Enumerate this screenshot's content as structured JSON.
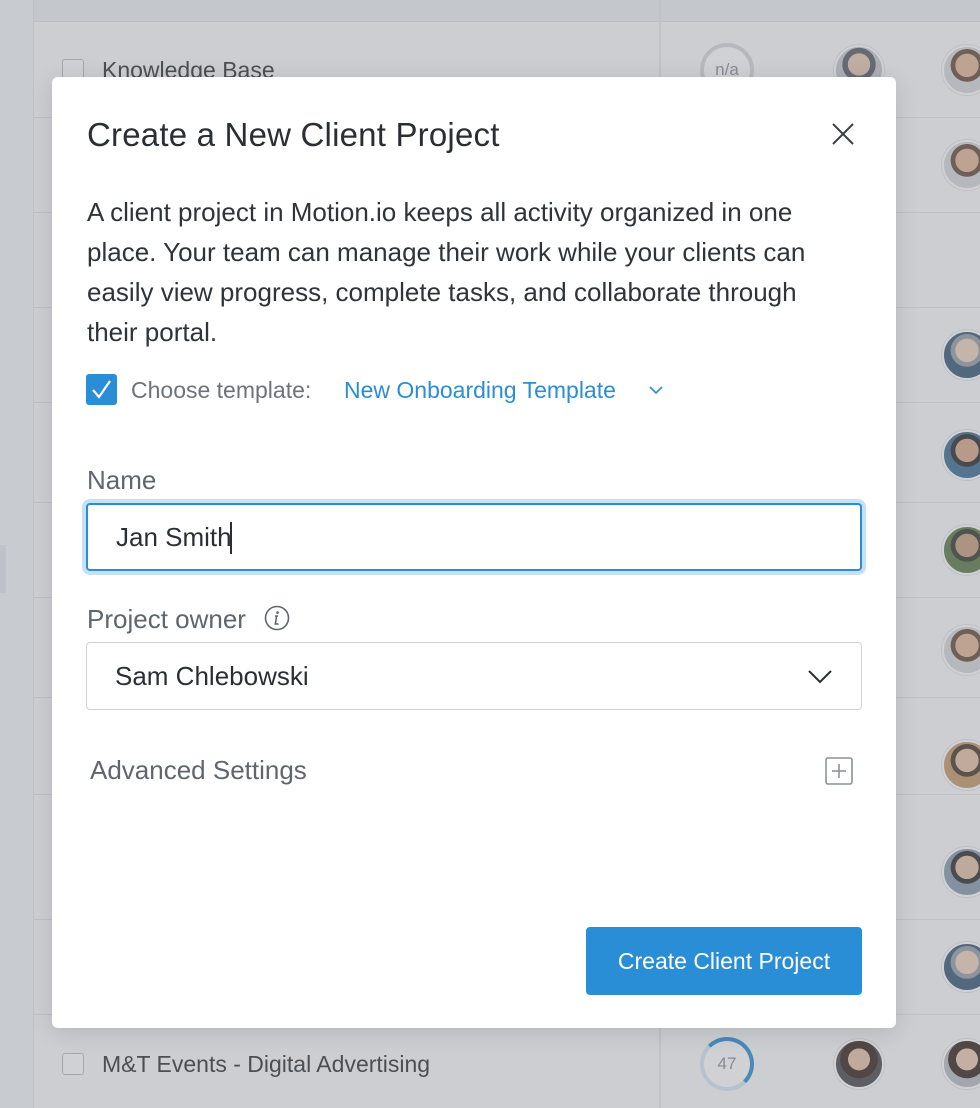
{
  "background": {
    "rows": [
      {
        "title": "Knowledge Base",
        "progress_text": "n/a"
      },
      {
        "title": "",
        "progress_text": ""
      },
      {
        "title": "",
        "progress_text": ""
      },
      {
        "title": "",
        "progress_text": ""
      },
      {
        "title": "",
        "progress_text": ""
      },
      {
        "title": "",
        "progress_text": ""
      },
      {
        "title": "",
        "progress_text": ""
      },
      {
        "title": "",
        "progress_text": ""
      },
      {
        "title": "",
        "progress_text": ""
      },
      {
        "title": "",
        "progress_text": ""
      },
      {
        "title": "M&T Events - Digital Advertising",
        "progress_text": "47"
      }
    ]
  },
  "modal": {
    "title": "Create a New Client Project",
    "description": "A client project in Motion.io keeps all activity organized in one place. Your team can manage their work while your clients can easily view progress, complete tasks, and collaborate through their portal.",
    "template": {
      "checked": true,
      "label": "Choose template:",
      "selected": "New Onboarding Template"
    },
    "name_field": {
      "label": "Name",
      "value": "Jan Smith"
    },
    "owner_field": {
      "label": "Project owner",
      "value": "Sam Chlebowski"
    },
    "advanced_settings_label": "Advanced Settings",
    "submit_label": "Create Client Project"
  },
  "colors": {
    "accent": "#2a8ed6",
    "text_primary": "#2b2f33",
    "text_secondary": "#5f666d"
  }
}
